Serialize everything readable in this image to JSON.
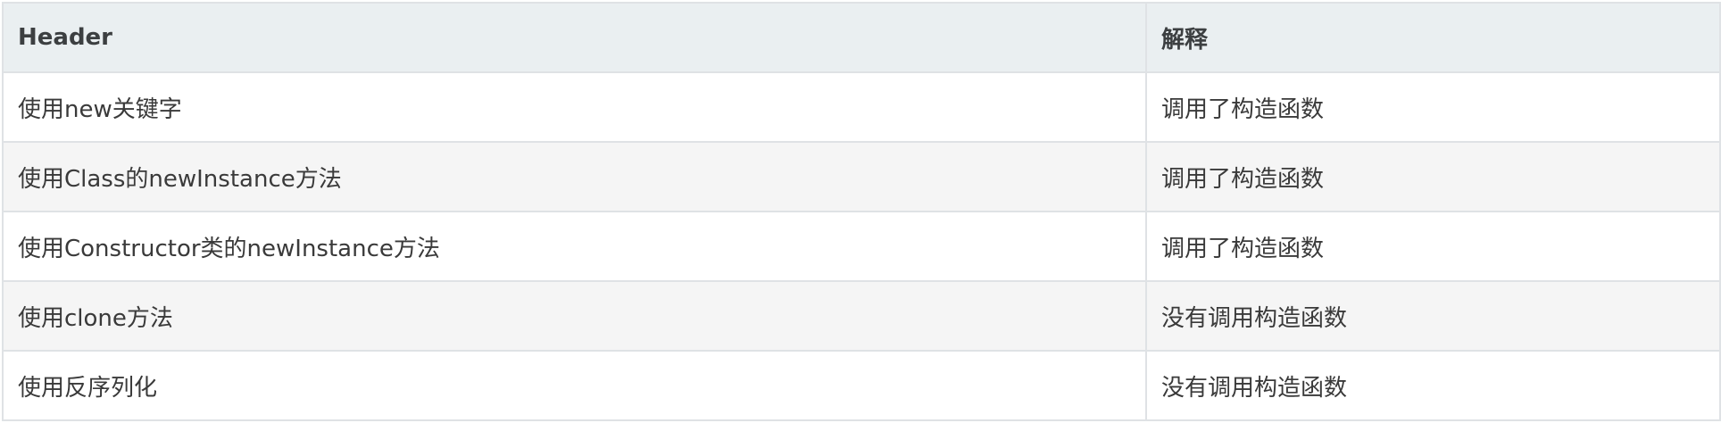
{
  "table": {
    "headers": [
      "Header",
      "解释"
    ],
    "rows": [
      [
        "使用new关键字",
        "调用了构造函数"
      ],
      [
        "使用Class的newInstance方法",
        "调用了构造函数"
      ],
      [
        "使用Constructor类的newInstance方法",
        "调用了构造函数"
      ],
      [
        "使用clone方法",
        "没有调用构造函数"
      ],
      [
        "使用反序列化",
        "没有调用构造函数"
      ]
    ]
  },
  "colors": {
    "header_bg": "#eaeff1",
    "row_alt_bg": "#f5f5f5",
    "border": "#dfe2e5",
    "text": "#3a3a3a"
  }
}
